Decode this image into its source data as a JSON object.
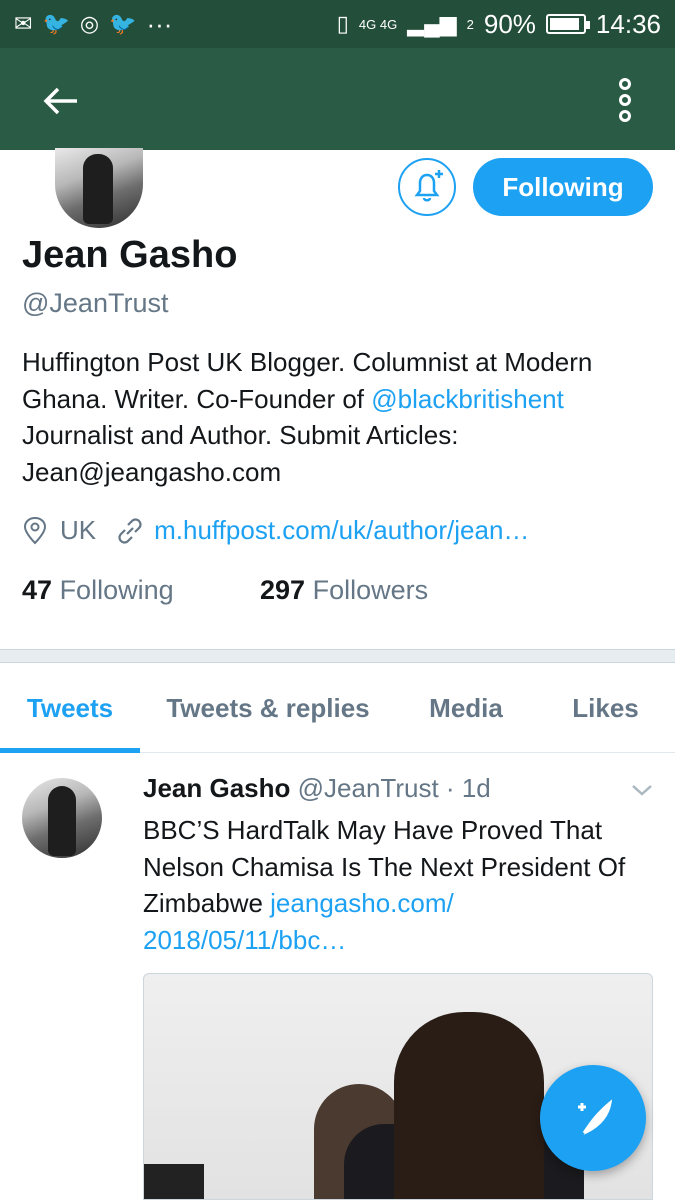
{
  "status_bar": {
    "left_icons": [
      "mail-icon",
      "twitter-icon",
      "instagram-icon",
      "twitter-icon"
    ],
    "overflow": "···",
    "network": "4G 4G",
    "sim": "2",
    "battery_percent": "90%",
    "battery_level": 0.9,
    "time": "14:36"
  },
  "app_bar": {
    "back_icon": "arrow-left-icon",
    "menu_icon": "kebab-menu-icon",
    "color": "#2a5b45"
  },
  "profile": {
    "name": "Jean Gasho",
    "handle": "@JeanTrust",
    "bio_1": "Huffington Post UK Blogger. Columnist at Modern Ghana. Writer. Co-Founder of ",
    "bio_mention": "@blackbritishent",
    "bio_2": " Journalist and Author. Submit Articles: Jean@jeangasho.com",
    "location": "UK",
    "website": "m.huffpost.com/uk/author/jean…",
    "following_count": "47",
    "following_label": "Following",
    "followers_count": "297",
    "followers_label": "Followers",
    "follow_button": "Following"
  },
  "tabs": [
    {
      "label": "Tweets",
      "active": true
    },
    {
      "label": "Tweets & replies",
      "active": false
    },
    {
      "label": "Media",
      "active": false
    },
    {
      "label": "Likes",
      "active": false
    }
  ],
  "tweet": {
    "author": "Jean Gasho",
    "handle": "@JeanTrust",
    "dot": "·",
    "time": "1d",
    "text": "BBC’S HardTalk May Have Proved That Nelson Chamisa Is The Next President Of Zimbabwe ",
    "link": "jeangasho.com/ 2018/05/11/bbc…"
  },
  "colors": {
    "accent": "#1da1f2",
    "appbar": "#2a5b45",
    "statusbar": "#234e3a",
    "text_primary": "#14171a",
    "text_secondary": "#657786"
  }
}
